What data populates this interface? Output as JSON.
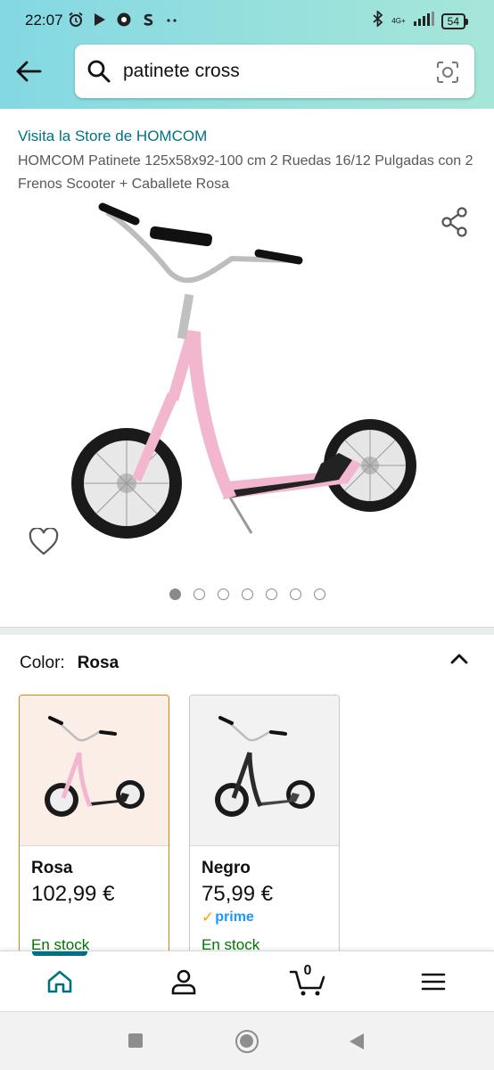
{
  "status_bar": {
    "time": "22:07",
    "network": "4G+",
    "battery": "54"
  },
  "search": {
    "query": "patinete cross"
  },
  "product": {
    "store_link": "Visita la Store de HOMCOM",
    "title": "HOMCOM Patinete 125x58x92-100 cm 2 Ruedas 16/12 Pulgadas con 2 Frenos Scooter + Caballete Rosa",
    "image_count": 7,
    "active_image": 1
  },
  "color_selector": {
    "label": "Color:",
    "selected": "Rosa",
    "options": [
      {
        "name": "Rosa",
        "price": "102,99 €",
        "prime": "",
        "stock": "En stock",
        "frame_color": "#f2b7cf"
      },
      {
        "name": "Negro",
        "price": "75,99 €",
        "prime": "prime",
        "stock": "En stock",
        "frame_color": "#2b2b2b"
      }
    ]
  },
  "bottom_nav": {
    "cart_count": "0"
  },
  "colors": {
    "accent": "#007185",
    "header_bg": "#84d8e3",
    "stock_green": "#007600",
    "selected_border": "#c88719"
  }
}
